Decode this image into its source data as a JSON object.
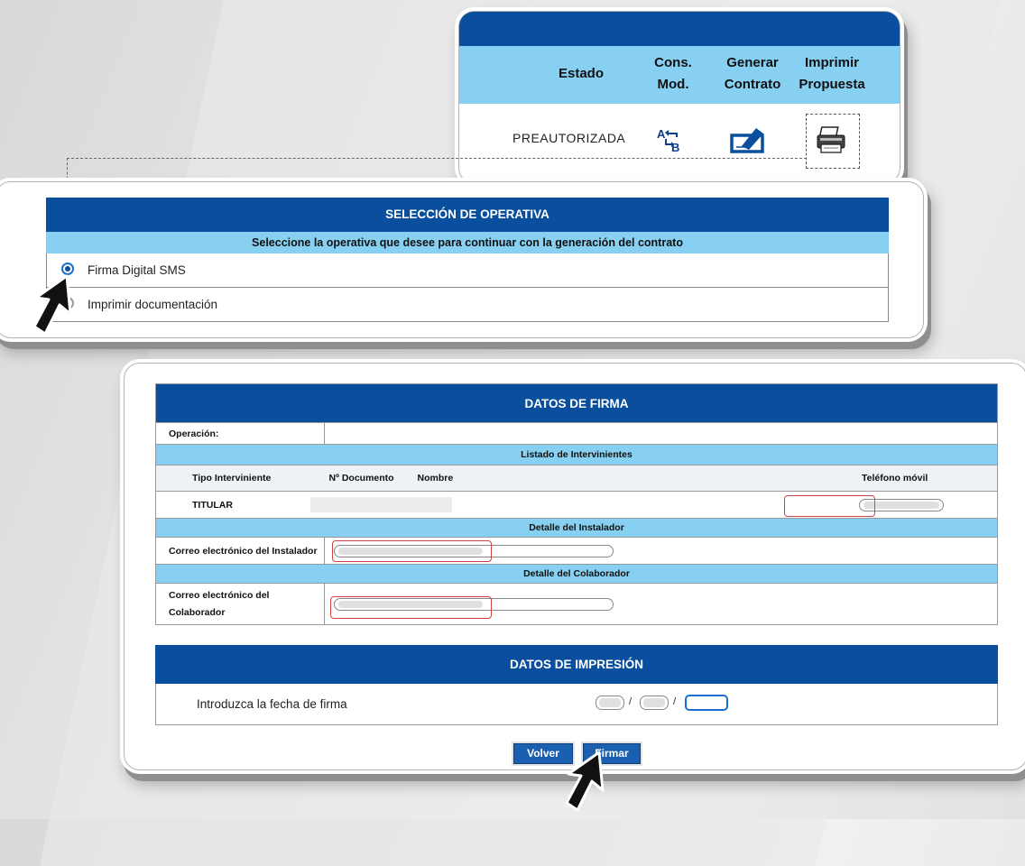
{
  "status_table": {
    "headers": {
      "estado": "Estado",
      "cons_mod": [
        "Cons.",
        "Mod."
      ],
      "generar_contrato": [
        "Generar",
        "Contrato"
      ],
      "imprimir_propuesta": [
        "Imprimir",
        "Propuesta"
      ]
    },
    "row": {
      "estado": "PREAUTORIZADA"
    },
    "icons": [
      "ab-swap-icon",
      "sign-contract-icon",
      "printer-icon"
    ]
  },
  "seleccion": {
    "title": "SELECCIÓN DE OPERATIVA",
    "subtitle": "Seleccione la operativa que desee para continuar con la generación del contrato",
    "options": [
      {
        "label": "Firma Digital SMS",
        "selected": true
      },
      {
        "label": "Imprimir documentación",
        "selected": false
      }
    ]
  },
  "datos_firma": {
    "title": "DATOS DE FIRMA",
    "operacion_label": "Operación:",
    "listado_title": "Listado de Intervinientes",
    "columns": {
      "tipo": "Tipo Interviniente",
      "documento": "Nº Documento",
      "nombre": "Nombre",
      "telefono": "Teléfono móvil"
    },
    "titular": "TITULAR",
    "instalador_title": "Detalle del Instalador",
    "instalador_label": "Correo electrónico del Instalador",
    "colaborador_title": "Detalle del Colaborador",
    "colaborador_label": [
      "Correo electrónico del",
      "Colaborador"
    ]
  },
  "datos_impresion": {
    "title": "DATOS DE IMPRESIÓN",
    "fecha_label": "Introduzca la fecha de firma",
    "separator": "/"
  },
  "buttons": {
    "volver": "Volver",
    "firmar": "Firmar"
  },
  "colors": {
    "header_dark": "#0a4f9e",
    "header_light": "#87d0f1",
    "highlight_red": "#c44444"
  }
}
